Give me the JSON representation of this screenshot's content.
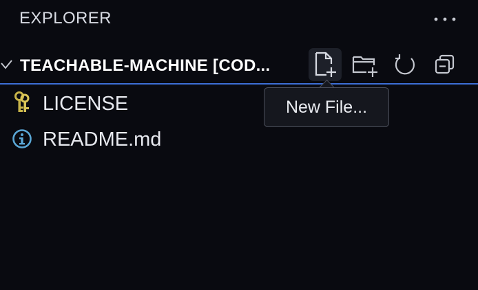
{
  "explorer": {
    "title": "EXPLORER",
    "more_icon": "ellipsis-icon"
  },
  "section": {
    "folder_name": "TEACHABLE-MACHINE [COD...",
    "expanded": true,
    "actions": [
      {
        "name": "new-file-button",
        "icon": "new-file-icon",
        "active": true
      },
      {
        "name": "new-folder-button",
        "icon": "new-folder-icon",
        "active": false
      },
      {
        "name": "refresh-explorer-button",
        "icon": "refresh-icon",
        "active": false
      },
      {
        "name": "collapse-folders-button",
        "icon": "collapse-all-icon",
        "active": false
      }
    ],
    "accent_color": "#3d6fd6"
  },
  "tooltip": {
    "text": "New File..."
  },
  "files": [
    {
      "label": "LICENSE",
      "icon": "key-icon",
      "icon_color": "#c9b54a"
    },
    {
      "label": "README.md",
      "icon": "info-icon",
      "icon_color": "#5aa7d6"
    }
  ]
}
